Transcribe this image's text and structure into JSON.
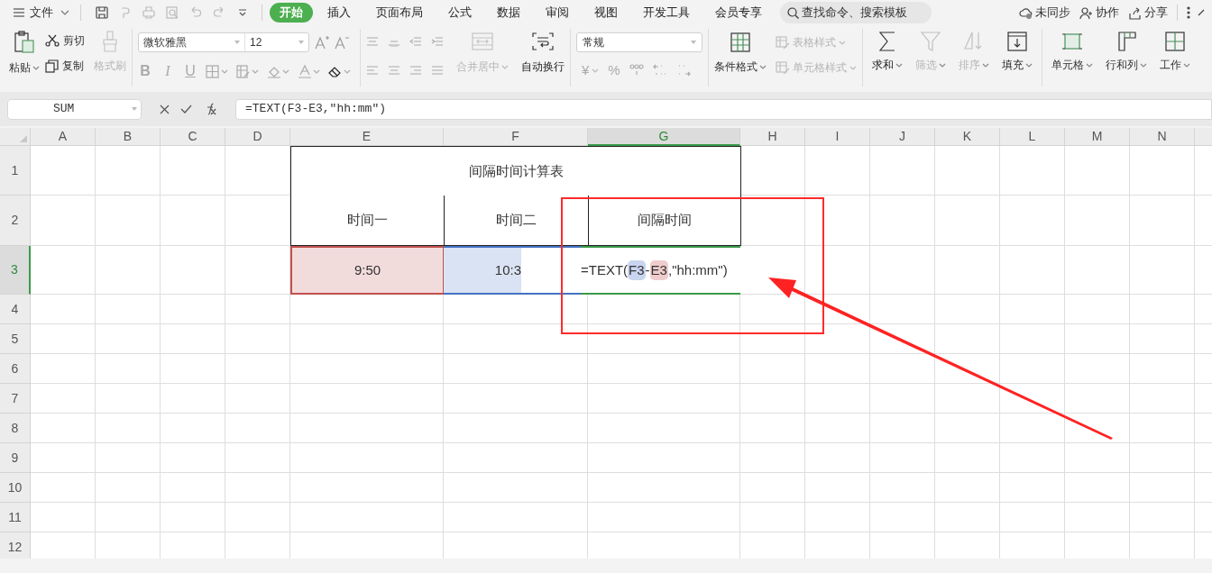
{
  "menu": {
    "file": "文件"
  },
  "tabs": [
    {
      "label": "开始",
      "selected": true
    },
    {
      "label": "插入",
      "selected": false
    },
    {
      "label": "页面布局",
      "selected": false
    },
    {
      "label": "公式",
      "selected": false
    },
    {
      "label": "数据",
      "selected": false
    },
    {
      "label": "审阅",
      "selected": false
    },
    {
      "label": "视图",
      "selected": false
    },
    {
      "label": "开发工具",
      "selected": false
    },
    {
      "label": "会员专享",
      "selected": false
    }
  ],
  "search": {
    "placeholder": "查找命令、搜索模板"
  },
  "top_actions": [
    {
      "label": "未同步",
      "kind": "cloud"
    },
    {
      "label": "协作",
      "kind": "user"
    },
    {
      "label": "分享",
      "kind": "share"
    }
  ],
  "ribbon": {
    "paste": "粘贴",
    "cut": "剪切",
    "copy": "复制",
    "format_painter": {
      "label": "格式刷",
      "disabled": true
    },
    "font": "微软雅黑",
    "size": "12",
    "font_buttons": [
      "B",
      "I",
      "U"
    ],
    "merge": {
      "label": "合并居中",
      "disabled": true
    },
    "wrap": {
      "label": "自动换行",
      "disabled": false
    },
    "number_format": "常规",
    "currency": "¥",
    "percent": "%",
    "conditional": "条件格式",
    "table_style": {
      "label": "表格样式",
      "disabled": true
    },
    "cell_style": {
      "label": "单元格样式",
      "disabled": true
    },
    "big_buttons": [
      {
        "label": "求和",
        "kind": "sum",
        "disabled": false
      },
      {
        "label": "筛选",
        "kind": "filter",
        "disabled": true
      },
      {
        "label": "排序",
        "kind": "sort",
        "disabled": true
      },
      {
        "label": "填充",
        "kind": "fill",
        "disabled": false
      }
    ],
    "cell_buttons": [
      {
        "label": "单元格",
        "kind": "cell"
      },
      {
        "label": "行和列",
        "kind": "rowcol"
      },
      {
        "label": "工作",
        "kind": "sheet"
      }
    ]
  },
  "formula_bar": {
    "name_box": "SUM",
    "formula": "=TEXT(F3-E3,\"hh:mm\")"
  },
  "sheet": {
    "columns": [
      {
        "label": "A",
        "selected": false
      },
      {
        "label": "B",
        "selected": false
      },
      {
        "label": "C",
        "selected": false
      },
      {
        "label": "D",
        "selected": false
      },
      {
        "label": "E",
        "selected": false
      },
      {
        "label": "F",
        "selected": false
      },
      {
        "label": "G",
        "selected": true
      },
      {
        "label": "H",
        "selected": false
      },
      {
        "label": "I",
        "selected": false
      },
      {
        "label": "J",
        "selected": false
      },
      {
        "label": "K",
        "selected": false
      },
      {
        "label": "L",
        "selected": false
      },
      {
        "label": "M",
        "selected": false
      },
      {
        "label": "N",
        "selected": false
      }
    ],
    "rows": [
      {
        "label": "1",
        "selected": false
      },
      {
        "label": "2",
        "selected": false
      },
      {
        "label": "3",
        "selected": true
      },
      {
        "label": "4",
        "selected": false
      },
      {
        "label": "5",
        "selected": false
      },
      {
        "label": "6",
        "selected": false
      },
      {
        "label": "7",
        "selected": false
      },
      {
        "label": "8",
        "selected": false
      },
      {
        "label": "9",
        "selected": false
      },
      {
        "label": "10",
        "selected": false
      },
      {
        "label": "11",
        "selected": false
      },
      {
        "label": "12",
        "selected": false
      }
    ],
    "title": "间隔时间计算表",
    "headers": [
      "时间一",
      "时间二",
      "间隔时间"
    ],
    "values": [
      {
        "text": "9:50",
        "color": "#c0504d"
      },
      {
        "text": "10:3",
        "color": "#4472c4"
      }
    ],
    "editor": [
      {
        "text": "=TEXT("
      },
      {
        "text": "F3",
        "color": "#c9d5f0"
      },
      {
        "text": "-"
      },
      {
        "text": "E3",
        "color": "#f0cccc"
      },
      {
        "text": ",\"hh:mm\")"
      }
    ]
  }
}
